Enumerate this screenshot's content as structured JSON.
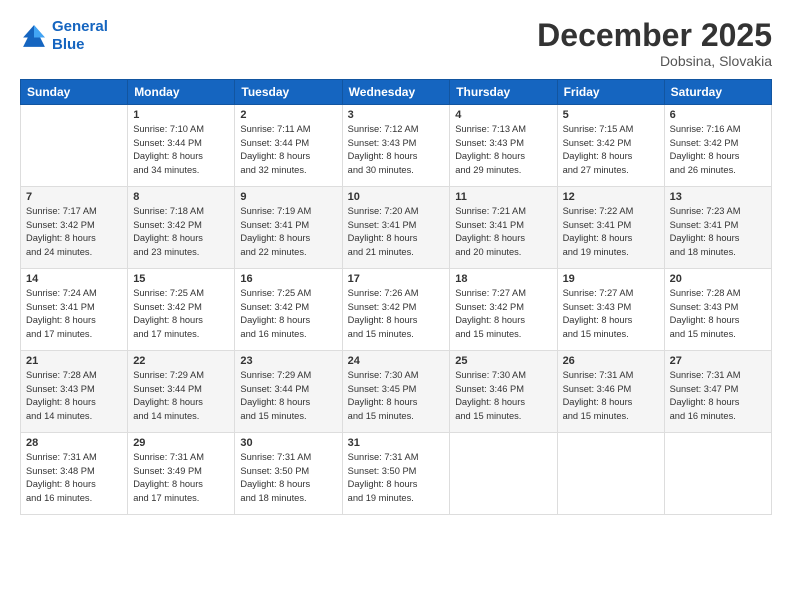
{
  "logo": {
    "line1": "General",
    "line2": "Blue"
  },
  "title": "December 2025",
  "location": "Dobsina, Slovakia",
  "weekdays": [
    "Sunday",
    "Monday",
    "Tuesday",
    "Wednesday",
    "Thursday",
    "Friday",
    "Saturday"
  ],
  "weeks": [
    [
      {
        "day": "",
        "info": ""
      },
      {
        "day": "1",
        "info": "Sunrise: 7:10 AM\nSunset: 3:44 PM\nDaylight: 8 hours\nand 34 minutes."
      },
      {
        "day": "2",
        "info": "Sunrise: 7:11 AM\nSunset: 3:44 PM\nDaylight: 8 hours\nand 32 minutes."
      },
      {
        "day": "3",
        "info": "Sunrise: 7:12 AM\nSunset: 3:43 PM\nDaylight: 8 hours\nand 30 minutes."
      },
      {
        "day": "4",
        "info": "Sunrise: 7:13 AM\nSunset: 3:43 PM\nDaylight: 8 hours\nand 29 minutes."
      },
      {
        "day": "5",
        "info": "Sunrise: 7:15 AM\nSunset: 3:42 PM\nDaylight: 8 hours\nand 27 minutes."
      },
      {
        "day": "6",
        "info": "Sunrise: 7:16 AM\nSunset: 3:42 PM\nDaylight: 8 hours\nand 26 minutes."
      }
    ],
    [
      {
        "day": "7",
        "info": "Sunrise: 7:17 AM\nSunset: 3:42 PM\nDaylight: 8 hours\nand 24 minutes."
      },
      {
        "day": "8",
        "info": "Sunrise: 7:18 AM\nSunset: 3:42 PM\nDaylight: 8 hours\nand 23 minutes."
      },
      {
        "day": "9",
        "info": "Sunrise: 7:19 AM\nSunset: 3:41 PM\nDaylight: 8 hours\nand 22 minutes."
      },
      {
        "day": "10",
        "info": "Sunrise: 7:20 AM\nSunset: 3:41 PM\nDaylight: 8 hours\nand 21 minutes."
      },
      {
        "day": "11",
        "info": "Sunrise: 7:21 AM\nSunset: 3:41 PM\nDaylight: 8 hours\nand 20 minutes."
      },
      {
        "day": "12",
        "info": "Sunrise: 7:22 AM\nSunset: 3:41 PM\nDaylight: 8 hours\nand 19 minutes."
      },
      {
        "day": "13",
        "info": "Sunrise: 7:23 AM\nSunset: 3:41 PM\nDaylight: 8 hours\nand 18 minutes."
      }
    ],
    [
      {
        "day": "14",
        "info": "Sunrise: 7:24 AM\nSunset: 3:41 PM\nDaylight: 8 hours\nand 17 minutes."
      },
      {
        "day": "15",
        "info": "Sunrise: 7:25 AM\nSunset: 3:42 PM\nDaylight: 8 hours\nand 17 minutes."
      },
      {
        "day": "16",
        "info": "Sunrise: 7:25 AM\nSunset: 3:42 PM\nDaylight: 8 hours\nand 16 minutes."
      },
      {
        "day": "17",
        "info": "Sunrise: 7:26 AM\nSunset: 3:42 PM\nDaylight: 8 hours\nand 15 minutes."
      },
      {
        "day": "18",
        "info": "Sunrise: 7:27 AM\nSunset: 3:42 PM\nDaylight: 8 hours\nand 15 minutes."
      },
      {
        "day": "19",
        "info": "Sunrise: 7:27 AM\nSunset: 3:43 PM\nDaylight: 8 hours\nand 15 minutes."
      },
      {
        "day": "20",
        "info": "Sunrise: 7:28 AM\nSunset: 3:43 PM\nDaylight: 8 hours\nand 15 minutes."
      }
    ],
    [
      {
        "day": "21",
        "info": "Sunrise: 7:28 AM\nSunset: 3:43 PM\nDaylight: 8 hours\nand 14 minutes."
      },
      {
        "day": "22",
        "info": "Sunrise: 7:29 AM\nSunset: 3:44 PM\nDaylight: 8 hours\nand 14 minutes."
      },
      {
        "day": "23",
        "info": "Sunrise: 7:29 AM\nSunset: 3:44 PM\nDaylight: 8 hours\nand 15 minutes."
      },
      {
        "day": "24",
        "info": "Sunrise: 7:30 AM\nSunset: 3:45 PM\nDaylight: 8 hours\nand 15 minutes."
      },
      {
        "day": "25",
        "info": "Sunrise: 7:30 AM\nSunset: 3:46 PM\nDaylight: 8 hours\nand 15 minutes."
      },
      {
        "day": "26",
        "info": "Sunrise: 7:31 AM\nSunset: 3:46 PM\nDaylight: 8 hours\nand 15 minutes."
      },
      {
        "day": "27",
        "info": "Sunrise: 7:31 AM\nSunset: 3:47 PM\nDaylight: 8 hours\nand 16 minutes."
      }
    ],
    [
      {
        "day": "28",
        "info": "Sunrise: 7:31 AM\nSunset: 3:48 PM\nDaylight: 8 hours\nand 16 minutes."
      },
      {
        "day": "29",
        "info": "Sunrise: 7:31 AM\nSunset: 3:49 PM\nDaylight: 8 hours\nand 17 minutes."
      },
      {
        "day": "30",
        "info": "Sunrise: 7:31 AM\nSunset: 3:50 PM\nDaylight: 8 hours\nand 18 minutes."
      },
      {
        "day": "31",
        "info": "Sunrise: 7:31 AM\nSunset: 3:50 PM\nDaylight: 8 hours\nand 19 minutes."
      },
      {
        "day": "",
        "info": ""
      },
      {
        "day": "",
        "info": ""
      },
      {
        "day": "",
        "info": ""
      }
    ]
  ]
}
